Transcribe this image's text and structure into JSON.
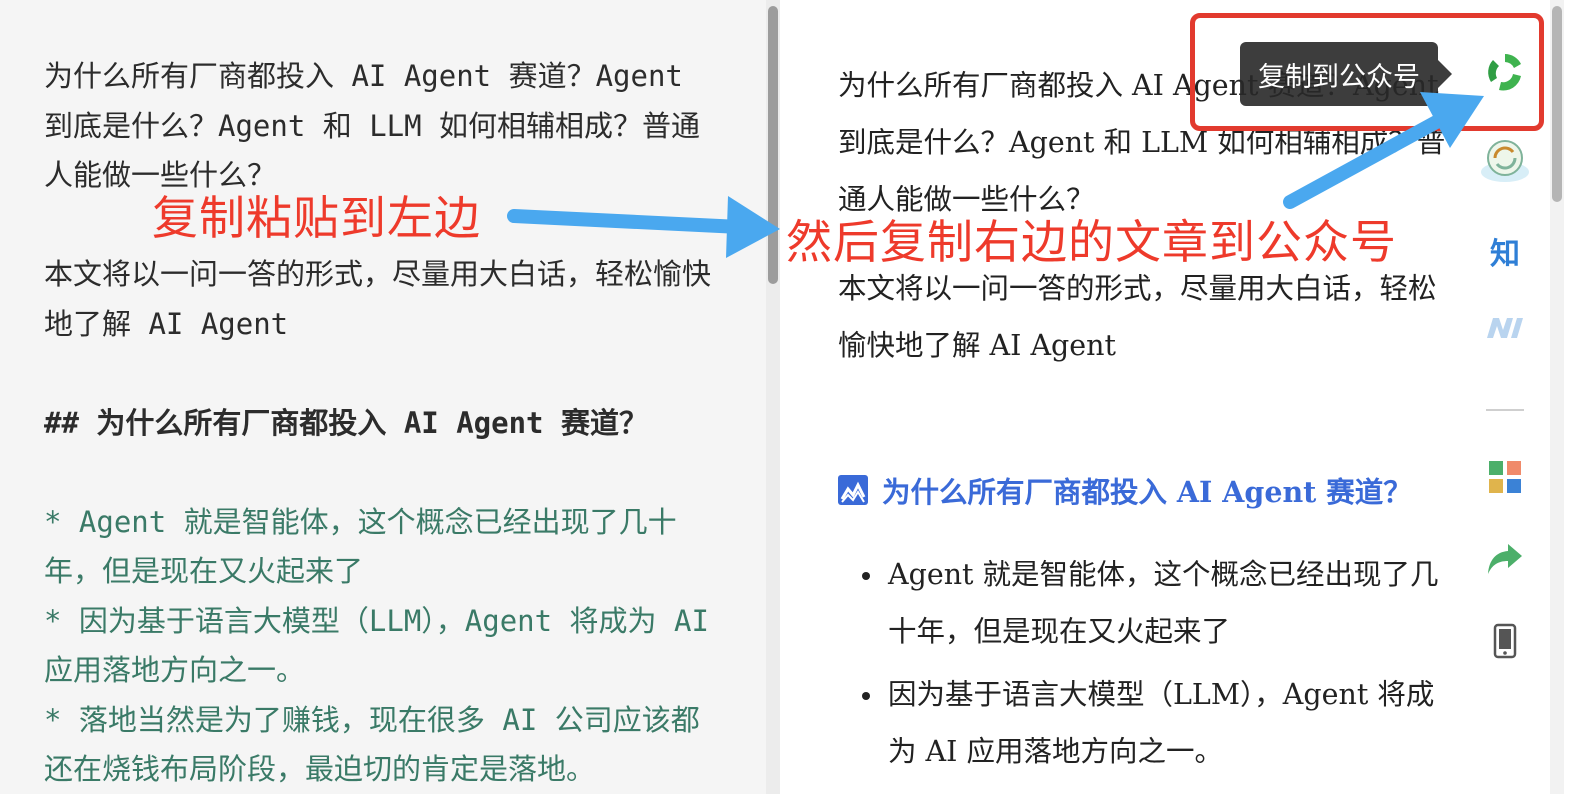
{
  "editor": {
    "para1": "为什么所有厂商都投入 AI Agent 赛道？Agent 到底是什么？Agent 和 LLM 如何相辅相成？普通人能做一些什么？",
    "para2": "本文将以一问一答的形式，尽量用大白话，轻松愉快地了解 AI Agent",
    "heading": "## 为什么所有厂商都投入 AI Agent 赛道？",
    "list": [
      "* Agent 就是智能体，这个概念已经出现了几十年，但是现在又火起来了",
      "* 因为基于语言大模型（LLM），Agent 将成为 AI 应用落地方向之一。",
      "* 落地当然是为了赚钱，现在很多 AI 公司应该都还在烧钱布局阶段，最迫切的肯定是落地。"
    ]
  },
  "preview": {
    "para1": "为什么所有厂商都投入 AI Agent 赛道？Agent 到底是什么？Agent 和 LLM 如何相辅相成？普通人能做一些什么？",
    "para2": "本文将以一问一答的形式，尽量用大白话，轻松愉快地了解 AI Agent",
    "heading": "为什么所有厂商都投入 AI Agent 赛道？",
    "list": [
      "Agent 就是智能体，这个概念已经出现了几十年，但是现在又火起来了",
      "因为基于语言大模型（LLM），Agent 将成为 AI 应用落地方向之一。"
    ]
  },
  "toolbar": {
    "tooltip": "复制到公众号",
    "zhihu_label": "知",
    "icons": [
      "wechat-copy-icon",
      "sync-cloud-icon",
      "zhihu-icon",
      "nuggets-icon",
      "grid-apps-icon",
      "share-icon",
      "mobile-icon"
    ]
  },
  "annotations": {
    "left": "复制粘贴到左边",
    "right": "然后复制右边的文章到公众号"
  },
  "colors": {
    "annotation_red": "#ee3a2b",
    "arrow_blue": "#4aa8ef",
    "heading_blue": "#3a6ad8",
    "list_green": "#3a7a67"
  }
}
